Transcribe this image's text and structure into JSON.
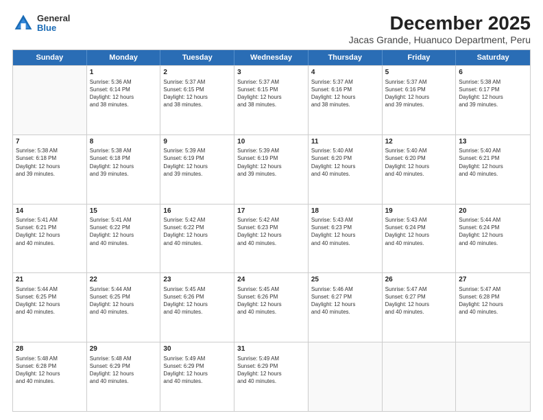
{
  "logo": {
    "general": "General",
    "blue": "Blue"
  },
  "title": "December 2025",
  "location": "Jacas Grande, Huanuco Department, Peru",
  "header_days": [
    "Sunday",
    "Monday",
    "Tuesday",
    "Wednesday",
    "Thursday",
    "Friday",
    "Saturday"
  ],
  "weeks": [
    [
      {
        "day": "",
        "info": "",
        "empty": true
      },
      {
        "day": "1",
        "info": "Sunrise: 5:36 AM\nSunset: 6:14 PM\nDaylight: 12 hours\nand 38 minutes."
      },
      {
        "day": "2",
        "info": "Sunrise: 5:37 AM\nSunset: 6:15 PM\nDaylight: 12 hours\nand 38 minutes."
      },
      {
        "day": "3",
        "info": "Sunrise: 5:37 AM\nSunset: 6:15 PM\nDaylight: 12 hours\nand 38 minutes."
      },
      {
        "day": "4",
        "info": "Sunrise: 5:37 AM\nSunset: 6:16 PM\nDaylight: 12 hours\nand 38 minutes."
      },
      {
        "day": "5",
        "info": "Sunrise: 5:37 AM\nSunset: 6:16 PM\nDaylight: 12 hours\nand 39 minutes."
      },
      {
        "day": "6",
        "info": "Sunrise: 5:38 AM\nSunset: 6:17 PM\nDaylight: 12 hours\nand 39 minutes."
      }
    ],
    [
      {
        "day": "7",
        "info": "Sunrise: 5:38 AM\nSunset: 6:18 PM\nDaylight: 12 hours\nand 39 minutes."
      },
      {
        "day": "8",
        "info": "Sunrise: 5:38 AM\nSunset: 6:18 PM\nDaylight: 12 hours\nand 39 minutes."
      },
      {
        "day": "9",
        "info": "Sunrise: 5:39 AM\nSunset: 6:19 PM\nDaylight: 12 hours\nand 39 minutes."
      },
      {
        "day": "10",
        "info": "Sunrise: 5:39 AM\nSunset: 6:19 PM\nDaylight: 12 hours\nand 39 minutes."
      },
      {
        "day": "11",
        "info": "Sunrise: 5:40 AM\nSunset: 6:20 PM\nDaylight: 12 hours\nand 40 minutes."
      },
      {
        "day": "12",
        "info": "Sunrise: 5:40 AM\nSunset: 6:20 PM\nDaylight: 12 hours\nand 40 minutes."
      },
      {
        "day": "13",
        "info": "Sunrise: 5:40 AM\nSunset: 6:21 PM\nDaylight: 12 hours\nand 40 minutes."
      }
    ],
    [
      {
        "day": "14",
        "info": "Sunrise: 5:41 AM\nSunset: 6:21 PM\nDaylight: 12 hours\nand 40 minutes."
      },
      {
        "day": "15",
        "info": "Sunrise: 5:41 AM\nSunset: 6:22 PM\nDaylight: 12 hours\nand 40 minutes."
      },
      {
        "day": "16",
        "info": "Sunrise: 5:42 AM\nSunset: 6:22 PM\nDaylight: 12 hours\nand 40 minutes."
      },
      {
        "day": "17",
        "info": "Sunrise: 5:42 AM\nSunset: 6:23 PM\nDaylight: 12 hours\nand 40 minutes."
      },
      {
        "day": "18",
        "info": "Sunrise: 5:43 AM\nSunset: 6:23 PM\nDaylight: 12 hours\nand 40 minutes."
      },
      {
        "day": "19",
        "info": "Sunrise: 5:43 AM\nSunset: 6:24 PM\nDaylight: 12 hours\nand 40 minutes."
      },
      {
        "day": "20",
        "info": "Sunrise: 5:44 AM\nSunset: 6:24 PM\nDaylight: 12 hours\nand 40 minutes."
      }
    ],
    [
      {
        "day": "21",
        "info": "Sunrise: 5:44 AM\nSunset: 6:25 PM\nDaylight: 12 hours\nand 40 minutes."
      },
      {
        "day": "22",
        "info": "Sunrise: 5:44 AM\nSunset: 6:25 PM\nDaylight: 12 hours\nand 40 minutes."
      },
      {
        "day": "23",
        "info": "Sunrise: 5:45 AM\nSunset: 6:26 PM\nDaylight: 12 hours\nand 40 minutes."
      },
      {
        "day": "24",
        "info": "Sunrise: 5:45 AM\nSunset: 6:26 PM\nDaylight: 12 hours\nand 40 minutes."
      },
      {
        "day": "25",
        "info": "Sunrise: 5:46 AM\nSunset: 6:27 PM\nDaylight: 12 hours\nand 40 minutes."
      },
      {
        "day": "26",
        "info": "Sunrise: 5:47 AM\nSunset: 6:27 PM\nDaylight: 12 hours\nand 40 minutes."
      },
      {
        "day": "27",
        "info": "Sunrise: 5:47 AM\nSunset: 6:28 PM\nDaylight: 12 hours\nand 40 minutes."
      }
    ],
    [
      {
        "day": "28",
        "info": "Sunrise: 5:48 AM\nSunset: 6:28 PM\nDaylight: 12 hours\nand 40 minutes."
      },
      {
        "day": "29",
        "info": "Sunrise: 5:48 AM\nSunset: 6:29 PM\nDaylight: 12 hours\nand 40 minutes."
      },
      {
        "day": "30",
        "info": "Sunrise: 5:49 AM\nSunset: 6:29 PM\nDaylight: 12 hours\nand 40 minutes."
      },
      {
        "day": "31",
        "info": "Sunrise: 5:49 AM\nSunset: 6:29 PM\nDaylight: 12 hours\nand 40 minutes."
      },
      {
        "day": "",
        "info": "",
        "empty": true
      },
      {
        "day": "",
        "info": "",
        "empty": true
      },
      {
        "day": "",
        "info": "",
        "empty": true
      }
    ]
  ]
}
